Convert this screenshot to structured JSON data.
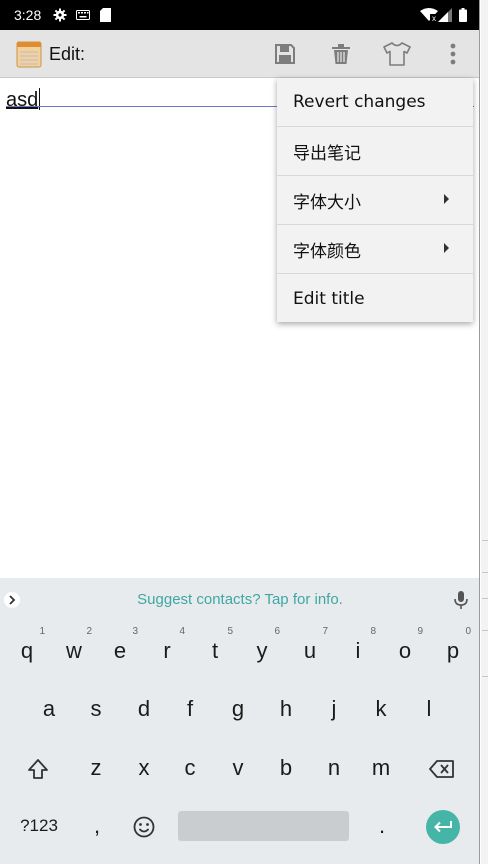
{
  "status_bar": {
    "time": "3:28",
    "left_icons": [
      "gear-icon",
      "keyboard-icon",
      "sim-card-icon"
    ],
    "right_icons": [
      "wifi-icon",
      "signal-icon",
      "battery-icon"
    ]
  },
  "toolbar": {
    "app_icon": "notepad-icon",
    "title": "Edit:",
    "actions": [
      "save-icon",
      "delete-icon",
      "shirt-icon",
      "more-vert-icon"
    ]
  },
  "editor": {
    "text": "asd"
  },
  "overflow_menu": {
    "items": [
      {
        "label": "Revert changes",
        "has_submenu": false
      },
      {
        "label": "导出笔记",
        "has_submenu": false
      },
      {
        "label": "字体大小",
        "has_submenu": true
      },
      {
        "label": "字体颜色",
        "has_submenu": true
      },
      {
        "label": "Edit title",
        "has_submenu": false
      }
    ]
  },
  "keyboard": {
    "suggestion": "Suggest contacts? Tap for info.",
    "row1": [
      {
        "key": "q",
        "hint": "1"
      },
      {
        "key": "w",
        "hint": "2"
      },
      {
        "key": "e",
        "hint": "3"
      },
      {
        "key": "r",
        "hint": "4"
      },
      {
        "key": "t",
        "hint": "5"
      },
      {
        "key": "y",
        "hint": "6"
      },
      {
        "key": "u",
        "hint": "7"
      },
      {
        "key": "i",
        "hint": "8"
      },
      {
        "key": "o",
        "hint": "9"
      },
      {
        "key": "p",
        "hint": "0"
      }
    ],
    "row2": [
      "a",
      "s",
      "d",
      "f",
      "g",
      "h",
      "j",
      "k",
      "l"
    ],
    "row3": [
      "z",
      "x",
      "c",
      "v",
      "b",
      "n",
      "m"
    ],
    "symbols_label": "?123",
    "comma": ",",
    "period": "."
  },
  "colors": {
    "toolbar_bg": "#e4e4e4",
    "menu_bg": "#f2f2f2",
    "keyboard_bg": "#e8ebed",
    "accent_teal": "#45b5a7",
    "suggestion_text": "#3fa7a2"
  }
}
